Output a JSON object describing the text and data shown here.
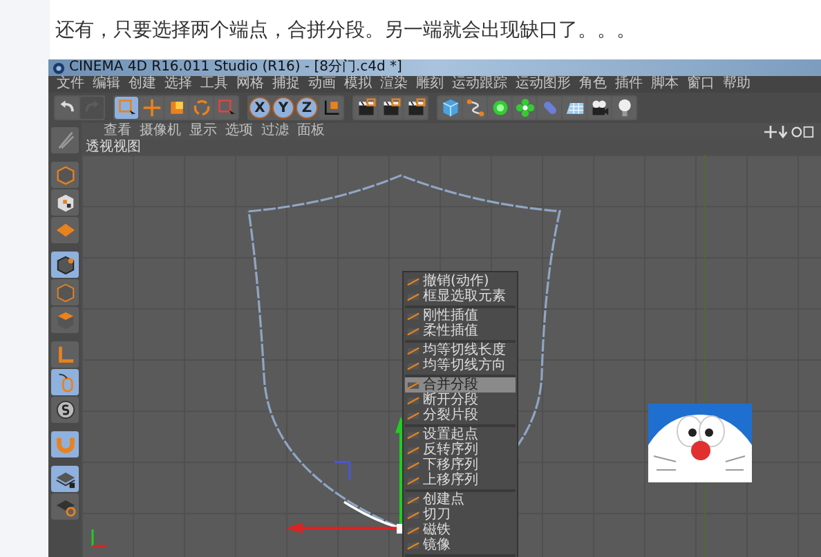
{
  "heading": "还有，只要选择两个端点，合拼分段。另一端就会出现缺口了。。。",
  "app": {
    "title": "CINEMA 4D R16.011 Studio (R16) - [8分门.c4d *]",
    "menu": [
      "文件",
      "编辑",
      "创建",
      "选择",
      "工具",
      "网格",
      "捕捉",
      "动画",
      "模拟",
      "渲染",
      "雕刻",
      "运动跟踪",
      "运动图形",
      "角色",
      "插件",
      "脚本",
      "窗口",
      "帮助"
    ],
    "toolbar": [
      [
        {
          "kind": "icon",
          "active": false,
          "disabled": false
        },
        {
          "kind": "icon",
          "active": false,
          "disabled": true
        }
      ],
      [
        {
          "kind": "icon",
          "active": true
        },
        {
          "kind": "icon",
          "active": false
        },
        {
          "kind": "icon",
          "active": false
        },
        {
          "kind": "icon",
          "active": false
        },
        {
          "kind": "icon",
          "active": false
        }
      ],
      [
        {
          "kind": "axis",
          "label": "X",
          "active": true
        },
        {
          "kind": "axis",
          "label": "Y",
          "active": true
        },
        {
          "kind": "axis",
          "label": "Z",
          "active": true
        },
        {
          "kind": "icon",
          "active": false
        }
      ],
      [
        {
          "kind": "icon",
          "active": false
        },
        {
          "kind": "icon",
          "active": false
        },
        {
          "kind": "icon",
          "active": false
        }
      ],
      [
        {
          "kind": "icon",
          "active": false
        },
        {
          "kind": "icon",
          "active": false
        },
        {
          "kind": "icon",
          "active": false
        },
        {
          "kind": "icon",
          "active": false
        },
        {
          "kind": "icon",
          "active": false
        },
        {
          "kind": "icon",
          "active": false
        },
        {
          "kind": "icon",
          "active": false
        },
        {
          "kind": "icon",
          "active": false
        }
      ]
    ],
    "side_toolbar": [
      [
        {
          "active": false
        }
      ],
      [
        {
          "active": false
        },
        {
          "active": false
        },
        {
          "active": false
        }
      ],
      [
        {
          "active": true
        },
        {
          "active": false
        },
        {
          "active": false
        }
      ],
      [
        {
          "active": false
        },
        {
          "active": true
        },
        {
          "active": false
        }
      ],
      [
        {
          "active": true
        }
      ],
      [
        {
          "active": true
        },
        {
          "active": false
        }
      ]
    ],
    "viewport": {
      "menu": [
        "查看",
        "摄像机",
        "显示",
        "选项",
        "过滤",
        "面板"
      ],
      "tab": "透视视图",
      "context_menu": [
        [
          {
            "label": "撤销(动作)",
            "selected": false
          },
          {
            "label": "框显选取元素",
            "selected": false
          }
        ],
        [
          {
            "label": "刚性插值",
            "selected": false
          },
          {
            "label": "柔性插值",
            "selected": false
          }
        ],
        [
          {
            "label": "均等切线长度",
            "selected": false
          },
          {
            "label": "均等切线方向",
            "selected": false
          }
        ],
        [
          {
            "label": "合并分段",
            "selected": true
          },
          {
            "label": "断开分段",
            "selected": false
          },
          {
            "label": "分裂片段",
            "selected": false
          }
        ],
        [
          {
            "label": "设置起点",
            "selected": false
          },
          {
            "label": "反转序列",
            "selected": false
          },
          {
            "label": "下移序列",
            "selected": false
          },
          {
            "label": "上移序列",
            "selected": false
          }
        ],
        [
          {
            "label": "创建点",
            "selected": false
          },
          {
            "label": "切刀",
            "selected": false
          },
          {
            "label": "磁铁",
            "selected": false
          },
          {
            "label": "镜像",
            "selected": false
          }
        ]
      ]
    }
  }
}
